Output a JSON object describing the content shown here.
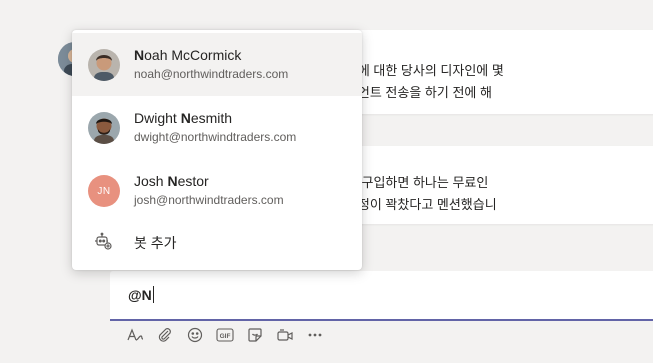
{
  "messages": [
    {
      "line1": "클라이언트는 Josh에 대한 당사의 디자인에 몇",
      "line2": "기는 수요일 클라이언트 전송을 하기 전에 해"
    },
    {
      "line1": "에는 하나의 제품을 구입하면 하나는 무료인",
      "line2": "일을 확인했지만 일정이 꽉찼다고 멘션했습니"
    }
  ],
  "mention_popup": {
    "people": [
      {
        "name_bold": "N",
        "name_rest": "oah McCormick",
        "email": "noah@northwindtraders.com",
        "active": true
      },
      {
        "name_pre": "Dwight ",
        "name_bold": "N",
        "name_rest": "esmith",
        "email": "dwight@northwindtraders.com"
      },
      {
        "name_pre": "Josh ",
        "name_bold": "N",
        "name_rest": "estor",
        "email": "josh@northwindtraders.com",
        "initials": "JN",
        "initials_color": "#e8917f"
      }
    ],
    "add_bot_label": "봇 추가"
  },
  "composer": {
    "value": "@N"
  },
  "toolbar": {
    "icons": [
      "format-icon",
      "attach-icon",
      "emoji-icon",
      "gif-icon",
      "sticker-icon",
      "meet-now-icon",
      "more-options-icon"
    ]
  },
  "colors": {
    "accent": "#6264a7",
    "initials_bg": "#e8917f"
  }
}
